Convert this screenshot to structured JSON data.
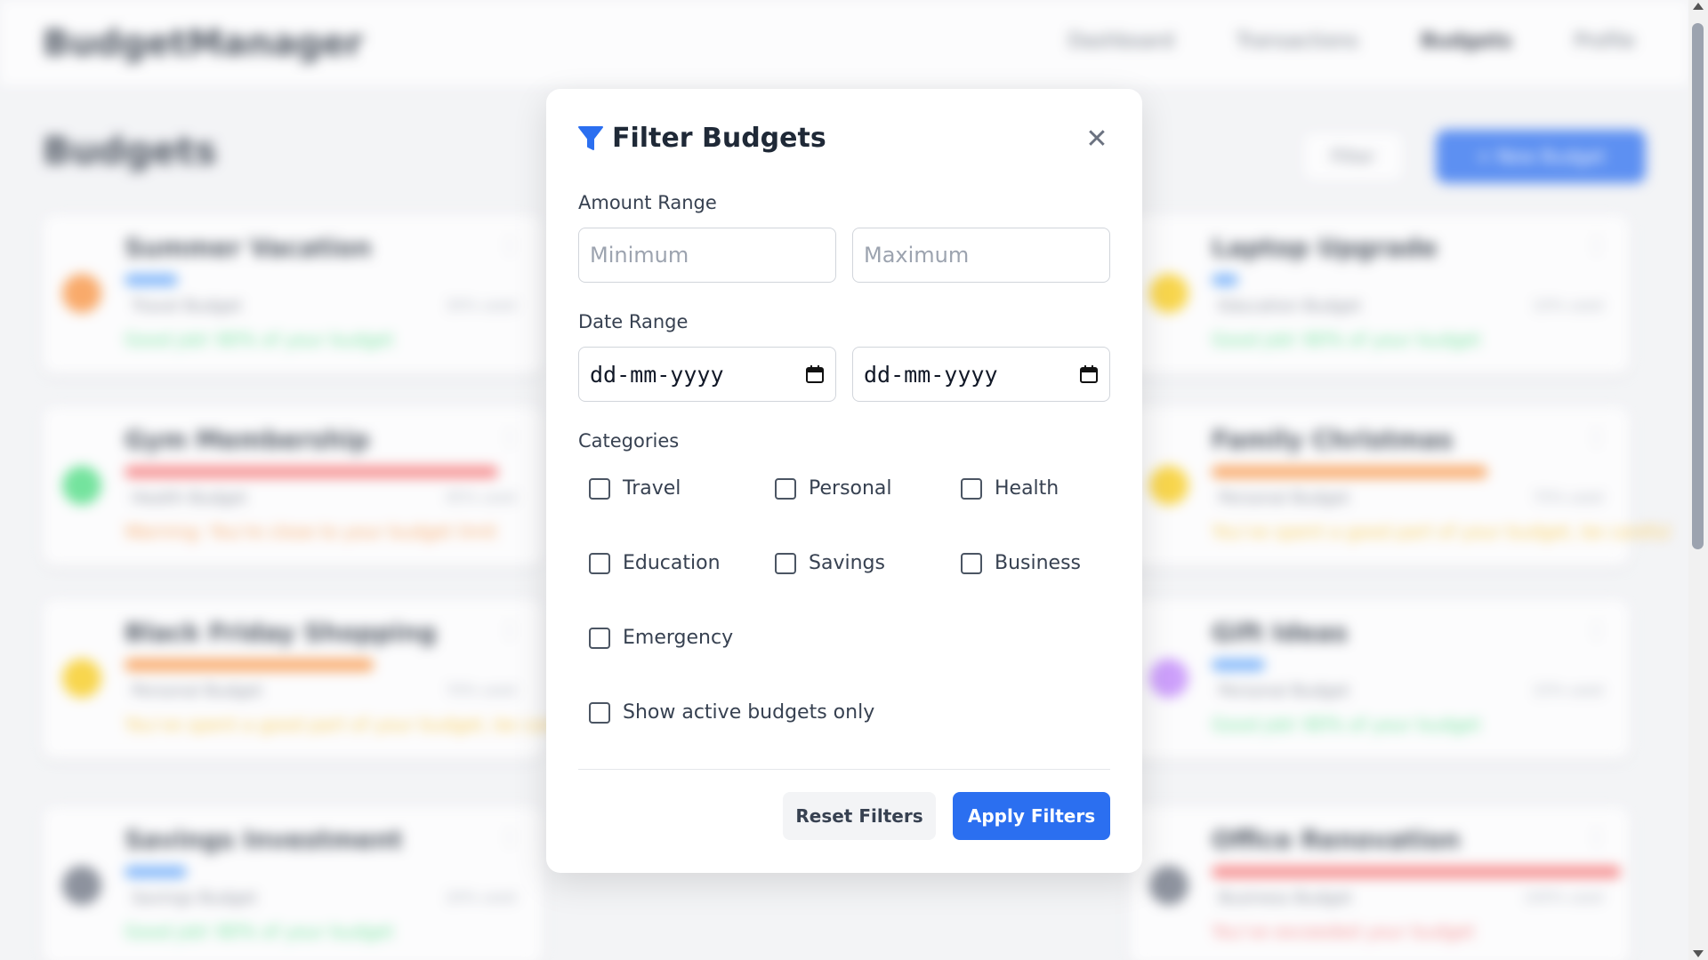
{
  "app": {
    "brand": "BudgetManager",
    "nav": [
      "Dashboard",
      "Transactions",
      "Budgets",
      "Profile"
    ],
    "page_title": "Budgets",
    "filter_label": "Filter",
    "new_budget_label": "+ New Budget"
  },
  "cards": [
    {
      "name": "Summer Vacation",
      "sub": "Travel Budget",
      "meta": "30% used",
      "status": "Good job! 80% of your budget",
      "dot": "#fb923c",
      "bar": "#60a5fa",
      "bar_w": 60,
      "status_color": "#4ade80"
    },
    {
      "name": "Gym Membership",
      "sub": "Health Budget",
      "meta": "95% used",
      "status": "Warning: You're close to your budget limit",
      "dot": "#4ade80",
      "bar": "#f87171",
      "bar_w": 420,
      "status_color": "#fb923c"
    },
    {
      "name": "Black Friday Shopping",
      "sub": "Personal Budget",
      "meta": "70% used",
      "status": "You've spent a good part of your budget, be careful",
      "dot": "#facc15",
      "bar": "#fb923c",
      "bar_w": 280,
      "status_color": "#fbbf24"
    },
    {
      "name": "Savings Investment",
      "sub": "Savings Budget",
      "meta": "20% used",
      "status": "Good job! 80% of your budget",
      "dot": "#6b7280",
      "bar": "#60a5fa",
      "bar_w": 70,
      "status_color": "#4ade80"
    },
    {
      "name": "Laptop Upgrade",
      "sub": "Education Budget",
      "meta": "10% used",
      "status": "Good job! 80% of your budget",
      "dot": "#facc15",
      "bar": "#60a5fa",
      "bar_w": 30,
      "status_color": "#4ade80"
    },
    {
      "name": "Family Christmas",
      "sub": "Personal Budget",
      "meta": "75% used",
      "status": "You've spent a good part of your budget, be careful",
      "dot": "#facc15",
      "bar": "#fb923c",
      "bar_w": 310,
      "status_color": "#fbbf24"
    },
    {
      "name": "Gift Ideas",
      "sub": "Personal Budget",
      "meta": "15% used",
      "status": "Good job! 80% of your budget",
      "dot": "#c084fc",
      "bar": "#60a5fa",
      "bar_w": 60,
      "status_color": "#4ade80"
    },
    {
      "name": "Office Renovation",
      "sub": "Business Budget",
      "meta": "100% used",
      "status": "You've exceeded your budget",
      "dot": "#6b7280",
      "bar": "#f87171",
      "bar_w": 460,
      "status_color": "#f87171"
    }
  ],
  "modal": {
    "title": "Filter Budgets",
    "close_icon": "close-icon",
    "amount_label": "Amount Range",
    "amount_min_placeholder": "Minimum",
    "amount_max_placeholder": "Maximum",
    "date_label": "Date Range",
    "date_from": "dd-mm-yyyy",
    "date_to": "dd-mm-yyyy",
    "categories_label": "Categories",
    "categories": [
      "Travel",
      "Personal",
      "Health",
      "Education",
      "Savings",
      "Business",
      "Emergency"
    ],
    "active_only_label": "Show active budgets only",
    "reset_label": "Reset Filters",
    "apply_label": "Apply Filters"
  },
  "colors": {
    "accent": "#2b6ff0",
    "text_primary": "#1f2937",
    "border": "#d1d5db"
  }
}
